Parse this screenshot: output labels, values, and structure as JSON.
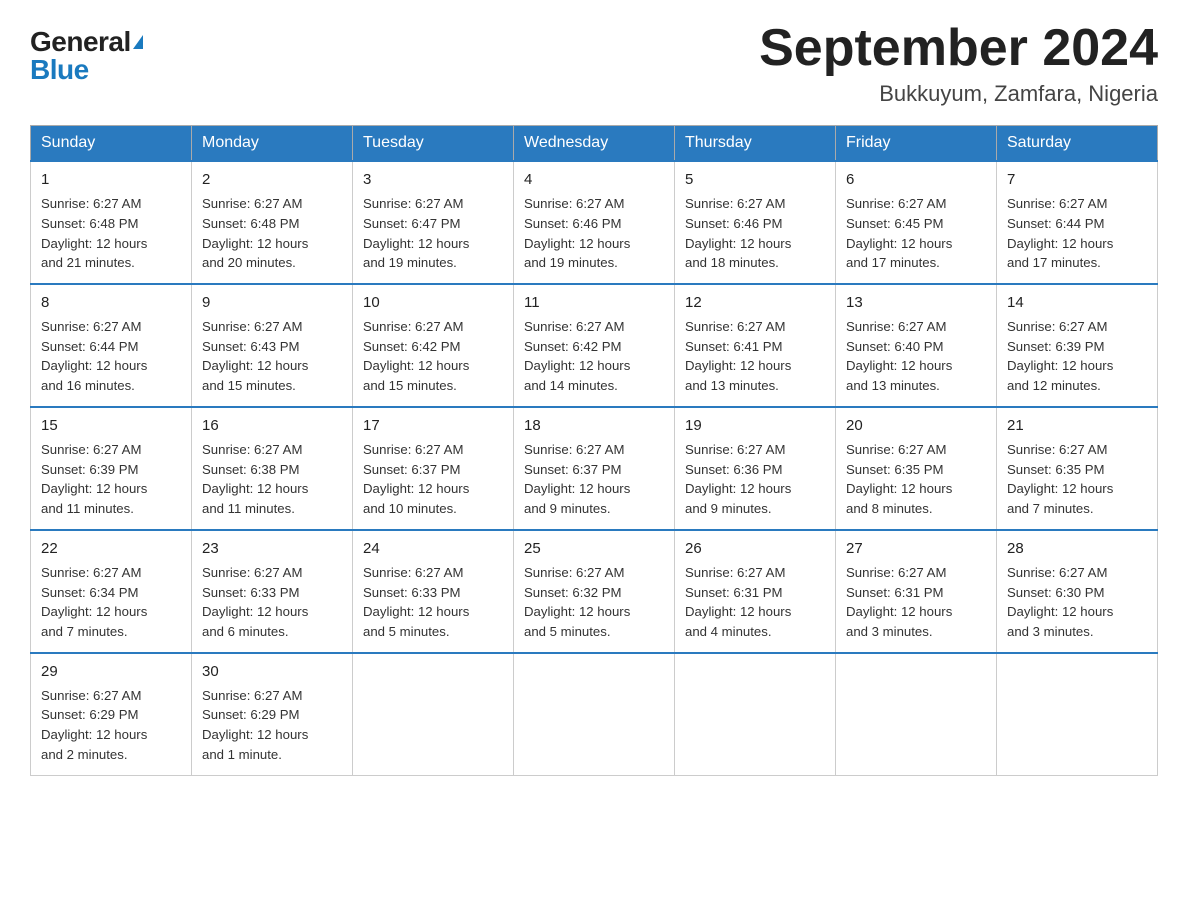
{
  "header": {
    "logo_general": "General",
    "logo_blue": "Blue",
    "title": "September 2024",
    "subtitle": "Bukkuyum, Zamfara, Nigeria"
  },
  "days_of_week": [
    "Sunday",
    "Monday",
    "Tuesday",
    "Wednesday",
    "Thursday",
    "Friday",
    "Saturday"
  ],
  "weeks": [
    [
      {
        "day": "1",
        "sunrise": "6:27 AM",
        "sunset": "6:48 PM",
        "daylight": "12 hours and 21 minutes."
      },
      {
        "day": "2",
        "sunrise": "6:27 AM",
        "sunset": "6:48 PM",
        "daylight": "12 hours and 20 minutes."
      },
      {
        "day": "3",
        "sunrise": "6:27 AM",
        "sunset": "6:47 PM",
        "daylight": "12 hours and 19 minutes."
      },
      {
        "day": "4",
        "sunrise": "6:27 AM",
        "sunset": "6:46 PM",
        "daylight": "12 hours and 19 minutes."
      },
      {
        "day": "5",
        "sunrise": "6:27 AM",
        "sunset": "6:46 PM",
        "daylight": "12 hours and 18 minutes."
      },
      {
        "day": "6",
        "sunrise": "6:27 AM",
        "sunset": "6:45 PM",
        "daylight": "12 hours and 17 minutes."
      },
      {
        "day": "7",
        "sunrise": "6:27 AM",
        "sunset": "6:44 PM",
        "daylight": "12 hours and 17 minutes."
      }
    ],
    [
      {
        "day": "8",
        "sunrise": "6:27 AM",
        "sunset": "6:44 PM",
        "daylight": "12 hours and 16 minutes."
      },
      {
        "day": "9",
        "sunrise": "6:27 AM",
        "sunset": "6:43 PM",
        "daylight": "12 hours and 15 minutes."
      },
      {
        "day": "10",
        "sunrise": "6:27 AM",
        "sunset": "6:42 PM",
        "daylight": "12 hours and 15 minutes."
      },
      {
        "day": "11",
        "sunrise": "6:27 AM",
        "sunset": "6:42 PM",
        "daylight": "12 hours and 14 minutes."
      },
      {
        "day": "12",
        "sunrise": "6:27 AM",
        "sunset": "6:41 PM",
        "daylight": "12 hours and 13 minutes."
      },
      {
        "day": "13",
        "sunrise": "6:27 AM",
        "sunset": "6:40 PM",
        "daylight": "12 hours and 13 minutes."
      },
      {
        "day": "14",
        "sunrise": "6:27 AM",
        "sunset": "6:39 PM",
        "daylight": "12 hours and 12 minutes."
      }
    ],
    [
      {
        "day": "15",
        "sunrise": "6:27 AM",
        "sunset": "6:39 PM",
        "daylight": "12 hours and 11 minutes."
      },
      {
        "day": "16",
        "sunrise": "6:27 AM",
        "sunset": "6:38 PM",
        "daylight": "12 hours and 11 minutes."
      },
      {
        "day": "17",
        "sunrise": "6:27 AM",
        "sunset": "6:37 PM",
        "daylight": "12 hours and 10 minutes."
      },
      {
        "day": "18",
        "sunrise": "6:27 AM",
        "sunset": "6:37 PM",
        "daylight": "12 hours and 9 minutes."
      },
      {
        "day": "19",
        "sunrise": "6:27 AM",
        "sunset": "6:36 PM",
        "daylight": "12 hours and 9 minutes."
      },
      {
        "day": "20",
        "sunrise": "6:27 AM",
        "sunset": "6:35 PM",
        "daylight": "12 hours and 8 minutes."
      },
      {
        "day": "21",
        "sunrise": "6:27 AM",
        "sunset": "6:35 PM",
        "daylight": "12 hours and 7 minutes."
      }
    ],
    [
      {
        "day": "22",
        "sunrise": "6:27 AM",
        "sunset": "6:34 PM",
        "daylight": "12 hours and 7 minutes."
      },
      {
        "day": "23",
        "sunrise": "6:27 AM",
        "sunset": "6:33 PM",
        "daylight": "12 hours and 6 minutes."
      },
      {
        "day": "24",
        "sunrise": "6:27 AM",
        "sunset": "6:33 PM",
        "daylight": "12 hours and 5 minutes."
      },
      {
        "day": "25",
        "sunrise": "6:27 AM",
        "sunset": "6:32 PM",
        "daylight": "12 hours and 5 minutes."
      },
      {
        "day": "26",
        "sunrise": "6:27 AM",
        "sunset": "6:31 PM",
        "daylight": "12 hours and 4 minutes."
      },
      {
        "day": "27",
        "sunrise": "6:27 AM",
        "sunset": "6:31 PM",
        "daylight": "12 hours and 3 minutes."
      },
      {
        "day": "28",
        "sunrise": "6:27 AM",
        "sunset": "6:30 PM",
        "daylight": "12 hours and 3 minutes."
      }
    ],
    [
      {
        "day": "29",
        "sunrise": "6:27 AM",
        "sunset": "6:29 PM",
        "daylight": "12 hours and 2 minutes."
      },
      {
        "day": "30",
        "sunrise": "6:27 AM",
        "sunset": "6:29 PM",
        "daylight": "12 hours and 1 minute."
      },
      null,
      null,
      null,
      null,
      null
    ]
  ],
  "labels": {
    "sunrise": "Sunrise:",
    "sunset": "Sunset:",
    "daylight": "Daylight:"
  }
}
